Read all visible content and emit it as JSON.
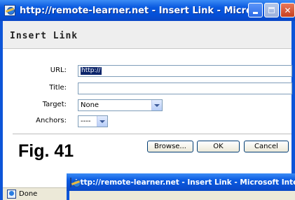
{
  "window": {
    "title": "http://remote-learner.net - Insert Link - Microsoft ..."
  },
  "dialog": {
    "heading": "Insert Link"
  },
  "form": {
    "url_label": "URL:",
    "url_value": "http://",
    "title_label": "Title:",
    "title_value": "",
    "target_label": "Target:",
    "target_value": "None",
    "anchors_label": "Anchors:",
    "anchors_value": "----"
  },
  "buttons": {
    "browse": "Browse...",
    "ok": "OK",
    "cancel": "Cancel"
  },
  "figure_label": "Fig. 41",
  "background_window": {
    "title": "http://remote-learner.net - Insert Link - Microsoft Inter"
  },
  "status": {
    "text": "Done"
  },
  "colors": {
    "titlebar": "#0a5ae0",
    "selection": "#0b246a",
    "dialog_header": "#eeeeee",
    "button_face": "#ece9d8"
  },
  "icons": [
    "ie-page-icon",
    "minimize-icon",
    "maximize-icon",
    "close-icon",
    "dropdown-arrow-icon"
  ]
}
